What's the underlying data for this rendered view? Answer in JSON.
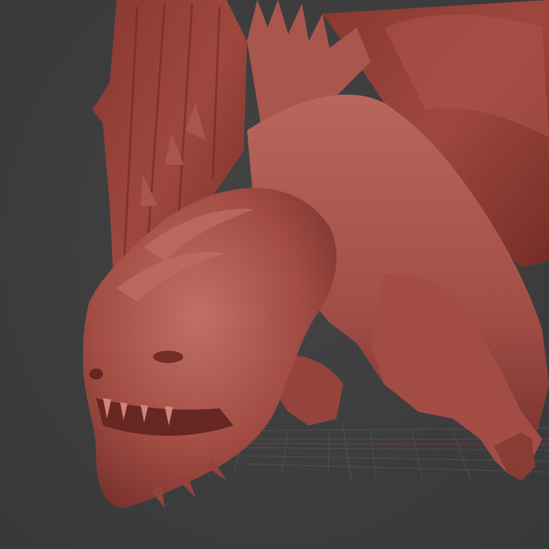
{
  "viewport": {
    "background_color": "#3c3c3d",
    "model": {
      "subject": "dragon-sculpt",
      "material_color": "#b0564c",
      "shadow_color": "#6e2b25",
      "highlight_color": "#d88a7f"
    },
    "grid": {
      "visible": true,
      "line_color": "#5a5a5c",
      "x_axis_color": "#8a3a3a",
      "y_axis_color": "#3f6e3f"
    }
  }
}
